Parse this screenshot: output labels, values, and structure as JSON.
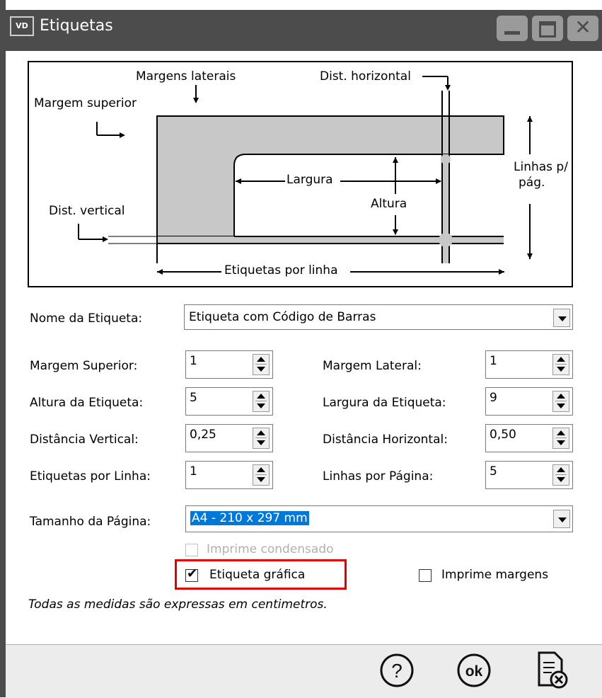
{
  "window": {
    "title": "Etiquetas",
    "app_icon_text": "VD",
    "controls": [
      "minimize",
      "maximize",
      "close"
    ]
  },
  "diagram": {
    "margens_laterais": "Margens laterais",
    "dist_horizontal": "Dist. horizontal",
    "margem_superior": "Margem superior",
    "largura": "Largura",
    "altura": "Altura",
    "linhas_pag_1": "Linhas p/",
    "linhas_pag_2": "pág.",
    "dist_vertical": "Dist. vertical",
    "etiquetas_por_linha": "Etiquetas por linha"
  },
  "form": {
    "nome_label": "Nome da Etiqueta:",
    "nome_value": "Etiqueta com Código de Barras",
    "margem_superior_label": "Margem Superior:",
    "margem_superior_value": "1",
    "margem_lateral_label": "Margem Lateral:",
    "margem_lateral_value": "1",
    "altura_label": "Altura da Etiqueta:",
    "altura_value": "5",
    "largura_label": "Largura da Etiqueta:",
    "largura_value": "9",
    "dist_vertical_label": "Distância Vertical:",
    "dist_vertical_value": "0,25",
    "dist_horizontal_label": "Distância Horizontal:",
    "dist_horizontal_value": "0,50",
    "etiquetas_linha_label": "Etiquetas por Linha:",
    "etiquetas_linha_value": "1",
    "linhas_pagina_label": "Linhas por Página:",
    "linhas_pagina_value": "5",
    "tamanho_label": "Tamanho da Página:",
    "tamanho_value": "A4 - 210 x 297 mm",
    "imprime_condensado": "Imprime condensado",
    "imprime_condensado_checked": false,
    "etiqueta_grafica": "Etiqueta gráfica",
    "etiqueta_grafica_checked": true,
    "imprime_margens": "Imprime margens",
    "imprime_margens_checked": false,
    "note": "Todas as medidas são expressas em centimetros."
  },
  "footer": {
    "icons": [
      "help-icon",
      "ok-icon",
      "cancel-document-icon"
    ]
  },
  "colors": {
    "titlebar": "#4c4c4c",
    "highlight": "#e00000",
    "selection": "#0078d7",
    "diagram_fill": "#c8c8c8"
  }
}
